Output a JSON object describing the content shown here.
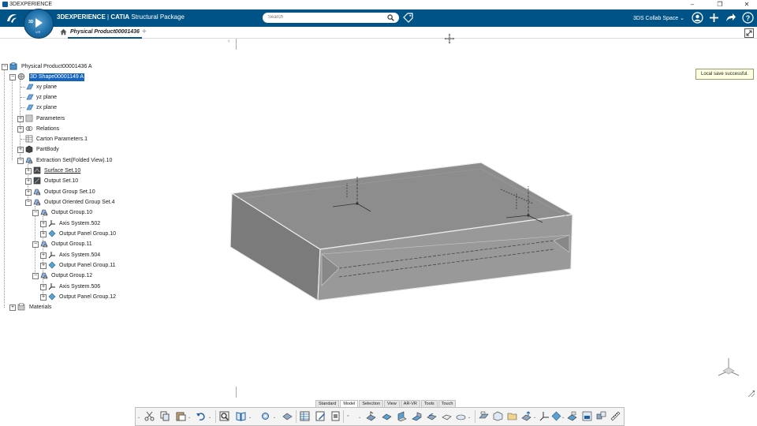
{
  "os_window": {
    "title": "3DEXPERIENCE",
    "minimize": "–",
    "restore": "❐",
    "close": "✕"
  },
  "header": {
    "brand_bold": "3DEXPERIENCE",
    "brand_sep": " | ",
    "brand_catia": "CATIA",
    "brand_app": " Structural Package",
    "compass_label": "3D",
    "compass_version": "V.R",
    "search_placeholder": "Search",
    "collab_space": "3DS Collab Space",
    "colors": {
      "bar": "#005386",
      "accent": "#1565c0"
    }
  },
  "tabs": {
    "active_label": "Physical Product00001436",
    "add_label": "+"
  },
  "tree": {
    "items": [
      {
        "label": "Physical Product00001436 A",
        "icon": "product-icon"
      },
      {
        "label": "3D Shape00001149 A",
        "icon": "shape-icon",
        "selected": true
      },
      {
        "label": "xy plane",
        "icon": "plane-icon"
      },
      {
        "label": "yz plane",
        "icon": "plane-icon"
      },
      {
        "label": "zx plane",
        "icon": "plane-icon"
      },
      {
        "label": "Parameters",
        "icon": "parameters-icon"
      },
      {
        "label": "Relations",
        "icon": "relations-icon"
      },
      {
        "label": "Carton Parameters.1",
        "icon": "table-icon"
      },
      {
        "label": "PartBody",
        "icon": "body-icon"
      },
      {
        "label": "Extraction Set(Folded View).10",
        "icon": "set-icon"
      },
      {
        "label": "Surface Set.10",
        "icon": "surface-set-icon"
      },
      {
        "label": "Output Set.10",
        "icon": "output-set-icon"
      },
      {
        "label": "Output Group Set.10",
        "icon": "group-set-icon"
      },
      {
        "label": "Output Oriented Group Set.4",
        "icon": "group-set-icon"
      },
      {
        "label": "Output Group.10",
        "icon": "group-icon"
      },
      {
        "label": "Axis System.502",
        "icon": "axis-icon"
      },
      {
        "label": "Output Panel Group.10",
        "icon": "panel-group-icon"
      },
      {
        "label": "Output Group.11",
        "icon": "group-icon"
      },
      {
        "label": "Axis System.504",
        "icon": "axis-icon"
      },
      {
        "label": "Output Panel Group.11",
        "icon": "panel-group-icon"
      },
      {
        "label": "Output Group.12",
        "icon": "group-icon"
      },
      {
        "label": "Axis System.506",
        "icon": "axis-icon"
      },
      {
        "label": "Output Panel Group.12",
        "icon": "panel-group-icon"
      },
      {
        "label": "Materials",
        "icon": "materials-icon"
      }
    ]
  },
  "notification": {
    "text": "Local save successful."
  },
  "action_bar": {
    "tabs": [
      "Standard",
      "Model",
      "Selection",
      "View",
      "AR-VR",
      "Tools",
      "Touch"
    ],
    "active_tab": "Model"
  }
}
